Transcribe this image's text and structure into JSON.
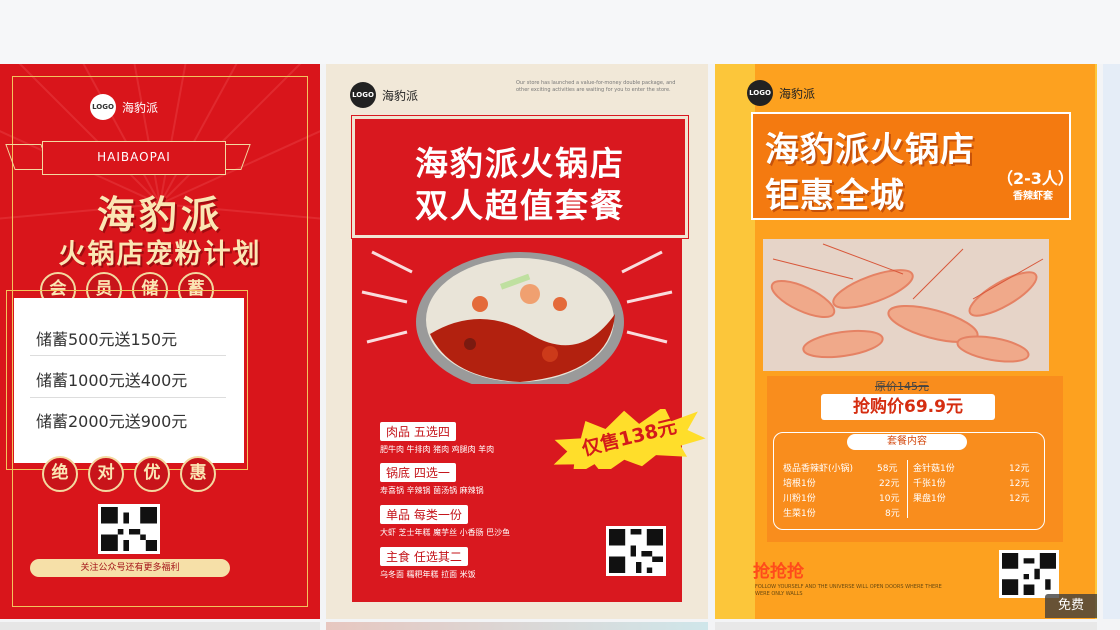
{
  "colors": {
    "card1_red": "#d9151b",
    "card2_red": "#d9181f",
    "card3_orange": "#fda11f",
    "gold": "#f3c35c"
  },
  "card1": {
    "logo": "LOGO",
    "brand": "海豹派",
    "banner": "HAIBAOPAI",
    "title_line1": "海豹派",
    "title_line2": "火锅店宠粉计划",
    "top_badges": [
      "会",
      "员",
      "储",
      "蓄"
    ],
    "offers": [
      "储蓄500元送150元",
      "储蓄1000元送400元",
      "储蓄2000元送900元"
    ],
    "bottom_badges": [
      "绝",
      "对",
      "优",
      "惠"
    ],
    "follow_text": "关注公众号还有更多福利"
  },
  "card2": {
    "logo": "LOGO",
    "brand": "海豹派",
    "tiny_text": "Our store has launched a value-for-money double package, and other exciting activities are waiting for you to enter the store.",
    "headline1": "海豹派火锅店",
    "headline2": "双人超值套餐",
    "categories": [
      {
        "title": "肉品 五选四",
        "items": "肥牛肉 牛排肉 猪肉 鸡腿肉 羊肉"
      },
      {
        "title": "锅底 四选一",
        "items": "寿喜锅 辛辣锅 菌汤锅 麻辣锅"
      },
      {
        "title": "单品 每类一份",
        "items": "大虾 芝士年糕 魔芋丝 小香肠 巴沙鱼"
      },
      {
        "title": "主食 任选其二",
        "items": "乌冬面 糯粑年糕 拉面 米饭"
      }
    ],
    "price_tag": "仅售138元"
  },
  "card3": {
    "logo": "LOGO",
    "brand": "海豹派",
    "title_line1": "海豹派火锅店",
    "title_line2": "钜惠全城",
    "sub_main": "（2-3人）",
    "sub_small": "香辣虾套",
    "original_price": "原价145元",
    "buy_price": "抢购价69.9元",
    "menu_title": "套餐内容",
    "menu_left": [
      {
        "name": "极品香辣虾(小锅)",
        "price": "58元"
      },
      {
        "name": "培根1份",
        "price": "22元"
      },
      {
        "name": "川粉1份",
        "price": "10元"
      },
      {
        "name": "生菜1份",
        "price": "8元"
      }
    ],
    "menu_right": [
      {
        "name": "金针菇1份",
        "price": "12元"
      },
      {
        "name": "千张1份",
        "price": "12元"
      },
      {
        "name": "果盘1份",
        "price": "12元"
      }
    ],
    "grab_text": "抢抢抢",
    "footer_text": "FOLLOW YOURSELF AND THE UNIVERSE WILL OPEN DOORS WHERE THERE WERE ONLY WALLS",
    "free_badge": "免费"
  }
}
